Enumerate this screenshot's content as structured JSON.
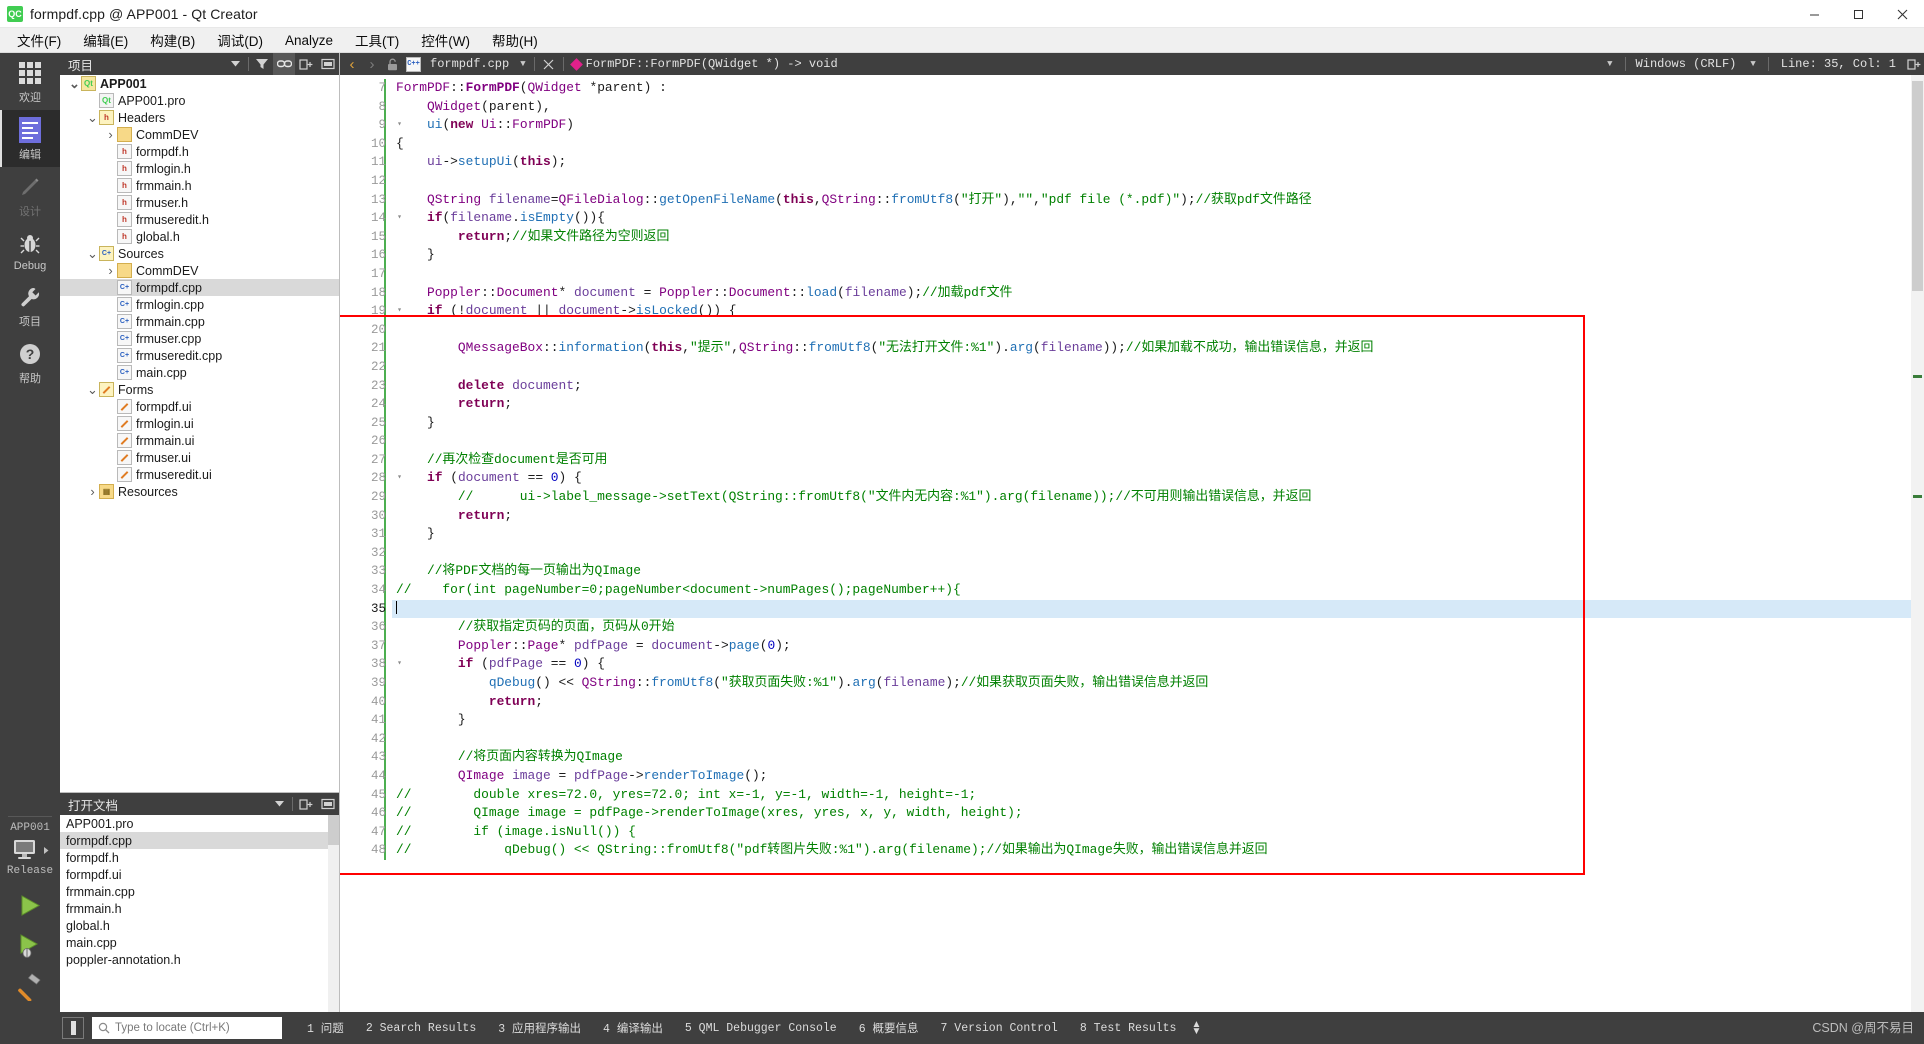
{
  "window": {
    "title": "formpdf.cpp @ APP001 - Qt Creator",
    "logo_text": "QC",
    "minimize_label": "minimize",
    "maximize_label": "maximize",
    "close_label": "close"
  },
  "menubar": [
    {
      "label": "文件(F)",
      "accel": "F"
    },
    {
      "label": "编辑(E)",
      "accel": "E"
    },
    {
      "label": "构建(B)",
      "accel": "B"
    },
    {
      "label": "调试(D)",
      "accel": "D"
    },
    {
      "label": "Analyze",
      "accel": "A"
    },
    {
      "label": "工具(T)",
      "accel": "T"
    },
    {
      "label": "控件(W)",
      "accel": "W"
    },
    {
      "label": "帮助(H)",
      "accel": "H"
    }
  ],
  "modebar": {
    "items": [
      {
        "label": "欢迎",
        "icon": "grid-icon",
        "state": "normal"
      },
      {
        "label": "编辑",
        "icon": "edit-lines-icon",
        "state": "active"
      },
      {
        "label": "设计",
        "icon": "pencil-icon",
        "state": "disabled"
      },
      {
        "label": "Debug",
        "icon": "bug-icon",
        "state": "normal"
      },
      {
        "label": "项目",
        "icon": "wrench-icon",
        "state": "normal"
      },
      {
        "label": "帮助",
        "icon": "question-mark-icon",
        "state": "normal"
      }
    ],
    "kit": {
      "project": "APP001",
      "target_icon": "desktop-icon",
      "configuration": "Release",
      "run_label": "run",
      "debug_label": "start-debugging",
      "build_label": "build"
    }
  },
  "projects_panel": {
    "title": "项目",
    "buttons": [
      "filter-icon",
      "link-icon",
      "split-icon",
      "close-icon"
    ],
    "tree": [
      {
        "depth": 0,
        "arrow": "down",
        "icon": "qt-project-icon",
        "label": "APP001",
        "bold": true,
        "selected": false
      },
      {
        "depth": 1,
        "arrow": "none",
        "icon": "pro-file-icon",
        "label": "APP001.pro",
        "bold": false,
        "selected": false
      },
      {
        "depth": 1,
        "arrow": "down",
        "icon": "headers-folder-icon",
        "label": "Headers",
        "bold": false,
        "selected": false
      },
      {
        "depth": 2,
        "arrow": "right",
        "icon": "folder-icon",
        "label": "CommDEV",
        "bold": false,
        "selected": false
      },
      {
        "depth": 2,
        "arrow": "none",
        "icon": "h-file-icon",
        "label": "formpdf.h",
        "bold": false,
        "selected": false
      },
      {
        "depth": 2,
        "arrow": "none",
        "icon": "h-file-icon",
        "label": "frmlogin.h",
        "bold": false,
        "selected": false
      },
      {
        "depth": 2,
        "arrow": "none",
        "icon": "h-file-icon",
        "label": "frmmain.h",
        "bold": false,
        "selected": false
      },
      {
        "depth": 2,
        "arrow": "none",
        "icon": "h-file-icon",
        "label": "frmuser.h",
        "bold": false,
        "selected": false
      },
      {
        "depth": 2,
        "arrow": "none",
        "icon": "h-file-icon",
        "label": "frmuseredit.h",
        "bold": false,
        "selected": false
      },
      {
        "depth": 2,
        "arrow": "none",
        "icon": "h-file-icon",
        "label": "global.h",
        "bold": false,
        "selected": false
      },
      {
        "depth": 1,
        "arrow": "down",
        "icon": "sources-folder-icon",
        "label": "Sources",
        "bold": false,
        "selected": false
      },
      {
        "depth": 2,
        "arrow": "right",
        "icon": "folder-icon",
        "label": "CommDEV",
        "bold": false,
        "selected": false
      },
      {
        "depth": 2,
        "arrow": "none",
        "icon": "cpp-file-icon",
        "label": "formpdf.cpp",
        "bold": false,
        "selected": true
      },
      {
        "depth": 2,
        "arrow": "none",
        "icon": "cpp-file-icon",
        "label": "frmlogin.cpp",
        "bold": false,
        "selected": false
      },
      {
        "depth": 2,
        "arrow": "none",
        "icon": "cpp-file-icon",
        "label": "frmmain.cpp",
        "bold": false,
        "selected": false
      },
      {
        "depth": 2,
        "arrow": "none",
        "icon": "cpp-file-icon",
        "label": "frmuser.cpp",
        "bold": false,
        "selected": false
      },
      {
        "depth": 2,
        "arrow": "none",
        "icon": "cpp-file-icon",
        "label": "frmuseredit.cpp",
        "bold": false,
        "selected": false
      },
      {
        "depth": 2,
        "arrow": "none",
        "icon": "cpp-file-icon",
        "label": "main.cpp",
        "bold": false,
        "selected": false
      },
      {
        "depth": 1,
        "arrow": "down",
        "icon": "forms-folder-icon",
        "label": "Forms",
        "bold": false,
        "selected": false
      },
      {
        "depth": 2,
        "arrow": "none",
        "icon": "ui-file-icon",
        "label": "formpdf.ui",
        "bold": false,
        "selected": false
      },
      {
        "depth": 2,
        "arrow": "none",
        "icon": "ui-file-icon",
        "label": "frmlogin.ui",
        "bold": false,
        "selected": false
      },
      {
        "depth": 2,
        "arrow": "none",
        "icon": "ui-file-icon",
        "label": "frmmain.ui",
        "bold": false,
        "selected": false
      },
      {
        "depth": 2,
        "arrow": "none",
        "icon": "ui-file-icon",
        "label": "frmuser.ui",
        "bold": false,
        "selected": false
      },
      {
        "depth": 2,
        "arrow": "none",
        "icon": "ui-file-icon",
        "label": "frmuseredit.ui",
        "bold": false,
        "selected": false
      },
      {
        "depth": 1,
        "arrow": "right",
        "icon": "resources-folder-icon",
        "label": "Resources",
        "bold": false,
        "selected": false
      }
    ]
  },
  "opendocs_panel": {
    "title": "打开文档",
    "buttons": [
      "split-icon",
      "close-icon"
    ],
    "items": [
      {
        "label": "APP001.pro",
        "selected": false
      },
      {
        "label": "formpdf.cpp",
        "selected": true
      },
      {
        "label": "formpdf.h",
        "selected": false
      },
      {
        "label": "formpdf.ui",
        "selected": false
      },
      {
        "label": "frmmain.cpp",
        "selected": false
      },
      {
        "label": "frmmain.h",
        "selected": false
      },
      {
        "label": "global.h",
        "selected": false
      },
      {
        "label": "main.cpp",
        "selected": false
      },
      {
        "label": "poppler-annotation.h",
        "selected": false
      }
    ]
  },
  "editor_toolbar": {
    "back_label": "go-back",
    "forward_label": "go-forward",
    "lock_label": "make-writable",
    "file_name": "formpdf.cpp",
    "close_label": "close-document",
    "symbol": "FormPDF::FormPDF(QWidget *) -> void",
    "line_ending": "Windows (CRLF)",
    "cursor_position": "Line: 35, Col: 1",
    "split_label": "split-editor"
  },
  "editor": {
    "first_line": 7,
    "current_line": 35,
    "lines": [
      {
        "n": 7,
        "fold": "none",
        "html": "<span class=\"ty\">FormPDF</span><span class=\"nm\">::</span><span class=\"ty bold\">FormPDF</span><span class=\"nm\">(</span><span class=\"ty\">QWidget</span> <span class=\"nm\">*parent) :</span>"
      },
      {
        "n": 8,
        "fold": "none",
        "html": "    <span class=\"ty\">QWidget</span><span class=\"nm\">(parent),</span>"
      },
      {
        "n": 9,
        "fold": "down",
        "html": "    <span class=\"fn\">ui</span><span class=\"nm\">(</span><span class=\"k\">new</span> <span class=\"ty\">Ui</span><span class=\"nm\">::</span><span class=\"ty\">FormPDF</span><span class=\"nm\">)</span>"
      },
      {
        "n": 10,
        "fold": "none",
        "html": "<span class=\"nm\">{</span>"
      },
      {
        "n": 11,
        "fold": "none",
        "html": "    <span class=\"vr\">ui</span><span class=\"nm\">-&gt;</span><span class=\"fn\">setupUi</span><span class=\"nm\">(</span><span class=\"k\">this</span><span class=\"nm\">);</span>"
      },
      {
        "n": 12,
        "fold": "none",
        "html": ""
      },
      {
        "n": 13,
        "fold": "none",
        "html": "    <span class=\"ty\">QString</span> <span class=\"vr\">filename</span><span class=\"nm\">=</span><span class=\"ty\">QFileDialog</span><span class=\"nm\">::</span><span class=\"fn\">getOpenFileName</span><span class=\"nm\">(</span><span class=\"k\">this</span><span class=\"nm\">,</span><span class=\"ty\">QString</span><span class=\"nm\">::</span><span class=\"fn\">fromUtf8</span><span class=\"nm\">(</span><span class=\"st\">\"打开\"</span><span class=\"nm\">),</span><span class=\"st\">\"\"</span><span class=\"nm\">,</span><span class=\"st\">\"pdf file (*.pdf)\"</span><span class=\"nm\">);</span><span class=\"cm\">//获取pdf文件路径</span>"
      },
      {
        "n": 14,
        "fold": "down",
        "html": "    <span class=\"k\">if</span><span class=\"nm\">(</span><span class=\"vr\">filename</span><span class=\"nm\">.</span><span class=\"fn\">isEmpty</span><span class=\"nm\">()){</span>"
      },
      {
        "n": 15,
        "fold": "none",
        "html": "        <span class=\"k\">return</span><span class=\"nm\">;</span><span class=\"cm\">//如果文件路径为空则返回</span>"
      },
      {
        "n": 16,
        "fold": "none",
        "html": "    <span class=\"nm\">}</span>"
      },
      {
        "n": 17,
        "fold": "none",
        "html": ""
      },
      {
        "n": 18,
        "fold": "none",
        "html": "    <span class=\"ty\">Poppler</span><span class=\"nm\">::</span><span class=\"ty\">Document</span><span class=\"nm\">* </span><span class=\"vr\">document</span> <span class=\"nm\">= </span><span class=\"ty\">Poppler</span><span class=\"nm\">::</span><span class=\"ty\">Document</span><span class=\"nm\">::</span><span class=\"fn\">load</span><span class=\"nm\">(</span><span class=\"vr\">filename</span><span class=\"nm\">);</span><span class=\"cm\">//加载pdf文件</span>"
      },
      {
        "n": 19,
        "fold": "down",
        "html": "    <span class=\"k\">if</span> <span class=\"nm\">(!</span><span class=\"vr\">document</span> <span class=\"nm\">|| </span><span class=\"vr\">document</span><span class=\"nm\">-&gt;</span><span class=\"fn\">isLocked</span><span class=\"nm\">()) {</span>"
      },
      {
        "n": 20,
        "fold": "none",
        "html": ""
      },
      {
        "n": 21,
        "fold": "none",
        "html": "        <span class=\"ty\">QMessageBox</span><span class=\"nm\">::</span><span class=\"fn\">information</span><span class=\"nm\">(</span><span class=\"k\">this</span><span class=\"nm\">,</span><span class=\"st\">\"提示\"</span><span class=\"nm\">,</span><span class=\"ty\">QString</span><span class=\"nm\">::</span><span class=\"fn\">fromUtf8</span><span class=\"nm\">(</span><span class=\"st\">\"无法打开文件:%1\"</span><span class=\"nm\">).</span><span class=\"fn\">arg</span><span class=\"nm\">(</span><span class=\"vr\">filename</span><span class=\"nm\">));</span><span class=\"cm\">//如果加载不成功，输出错误信息，并返回</span>"
      },
      {
        "n": 22,
        "fold": "none",
        "html": ""
      },
      {
        "n": 23,
        "fold": "none",
        "html": "        <span class=\"k\">delete</span> <span class=\"vr\">document</span><span class=\"nm\">;</span>"
      },
      {
        "n": 24,
        "fold": "none",
        "html": "        <span class=\"k\">return</span><span class=\"nm\">;</span>"
      },
      {
        "n": 25,
        "fold": "none",
        "html": "    <span class=\"nm\">}</span>"
      },
      {
        "n": 26,
        "fold": "none",
        "html": ""
      },
      {
        "n": 27,
        "fold": "none",
        "html": "    <span class=\"cm\">//再次检查document是否可用</span>"
      },
      {
        "n": 28,
        "fold": "down",
        "html": "    <span class=\"k\">if</span> <span class=\"nm\">(</span><span class=\"vr\">document</span> <span class=\"nm\">== </span><span class=\"num\">0</span><span class=\"nm\">) {</span>"
      },
      {
        "n": 29,
        "fold": "none",
        "html": "        <span class=\"cm\">//      ui-&gt;label_message-&gt;setText(QString::fromUtf8(\"文件内无内容:%1\").arg(filename));//不可用则输出错误信息，并返回</span>"
      },
      {
        "n": 30,
        "fold": "none",
        "html": "        <span class=\"k\">return</span><span class=\"nm\">;</span>"
      },
      {
        "n": 31,
        "fold": "none",
        "html": "    <span class=\"nm\">}</span>"
      },
      {
        "n": 32,
        "fold": "none",
        "html": ""
      },
      {
        "n": 33,
        "fold": "none",
        "html": "    <span class=\"cm\">//将PDF文档的每一页输出为QImage</span>"
      },
      {
        "n": 34,
        "fold": "none",
        "html": "<span class=\"cm\">//    for(int pageNumber=0;pageNumber&lt;document-&gt;numPages();pageNumber++){</span>"
      },
      {
        "n": 35,
        "fold": "none",
        "html": "",
        "current": true
      },
      {
        "n": 36,
        "fold": "none",
        "html": "        <span class=\"cm\">//获取指定页码的页面，页码从0开始</span>"
      },
      {
        "n": 37,
        "fold": "none",
        "html": "        <span class=\"ty\">Poppler</span><span class=\"nm\">::</span><span class=\"ty\">Page</span><span class=\"nm\">* </span><span class=\"vr\">pdfPage</span> <span class=\"nm\">= </span><span class=\"vr\">document</span><span class=\"nm\">-&gt;</span><span class=\"fn\">page</span><span class=\"nm\">(</span><span class=\"num\">0</span><span class=\"nm\">);</span>"
      },
      {
        "n": 38,
        "fold": "down",
        "html": "        <span class=\"k\">if</span> <span class=\"nm\">(</span><span class=\"vr\">pdfPage</span> <span class=\"nm\">== </span><span class=\"num\">0</span><span class=\"nm\">) {</span>"
      },
      {
        "n": 39,
        "fold": "none",
        "html": "            <span class=\"fn\">qDebug</span><span class=\"nm\">() &lt;&lt; </span><span class=\"ty\">QString</span><span class=\"nm\">::</span><span class=\"fn\">fromUtf8</span><span class=\"nm\">(</span><span class=\"st\">\"获取页面失败:%1\"</span><span class=\"nm\">).</span><span class=\"fn\">arg</span><span class=\"nm\">(</span><span class=\"vr\">filename</span><span class=\"nm\">);</span><span class=\"cm\">//如果获取页面失败，输出错误信息并返回</span>"
      },
      {
        "n": 40,
        "fold": "none",
        "html": "            <span class=\"k\">return</span><span class=\"nm\">;</span>"
      },
      {
        "n": 41,
        "fold": "none",
        "html": "        <span class=\"nm\">}</span>"
      },
      {
        "n": 42,
        "fold": "none",
        "html": ""
      },
      {
        "n": 43,
        "fold": "none",
        "html": "        <span class=\"cm\">//将页面内容转换为QImage</span>"
      },
      {
        "n": 44,
        "fold": "none",
        "html": "        <span class=\"ty\">QImage</span> <span class=\"vr\">image</span> <span class=\"nm\">= </span><span class=\"vr\">pdfPage</span><span class=\"nm\">-&gt;</span><span class=\"fn\">renderToImage</span><span class=\"nm\">();</span>"
      },
      {
        "n": 45,
        "fold": "none",
        "html": "<span class=\"cm\">//        double xres=72.0, yres=72.0; int x=-1, y=-1, width=-1, height=-1;</span>"
      },
      {
        "n": 46,
        "fold": "none",
        "html": "<span class=\"cm\">//        QImage image = pdfPage-&gt;renderToImage(xres, yres, x, y, width, height);</span>"
      },
      {
        "n": 47,
        "fold": "none",
        "html": "<span class=\"cm\">//        if (image.isNull()) {</span>"
      },
      {
        "n": 48,
        "fold": "none",
        "html": "<span class=\"cm\">//            qDebug() &lt;&lt; QString::fromUtf8(\"pdf转图片失败:%1\").arg(filename);//如果输出为QImage失败，输出错误信息并返回</span>"
      }
    ]
  },
  "statusbar": {
    "toggle_label": "toggle-output-pane",
    "locator_placeholder": "Type to locate (Ctrl+K)",
    "locator_value": "",
    "panes": [
      {
        "num": "1",
        "label": "问题"
      },
      {
        "num": "2",
        "label": "Search Results"
      },
      {
        "num": "3",
        "label": "应用程序输出"
      },
      {
        "num": "4",
        "label": "编译输出"
      },
      {
        "num": "5",
        "label": "QML Debugger Console"
      },
      {
        "num": "6",
        "label": "概要信息"
      },
      {
        "num": "7",
        "label": "Version Control"
      },
      {
        "num": "8",
        "label": "Test Results"
      }
    ],
    "watermark": "CSDN @周不易目"
  },
  "colors": {
    "accent_green": "#41cd52",
    "highlight_line": "#d6e9f8",
    "annotation_red": "#ff0000",
    "dark_panel": "#3f3f3f",
    "mode_active": "#2c2c2c"
  }
}
